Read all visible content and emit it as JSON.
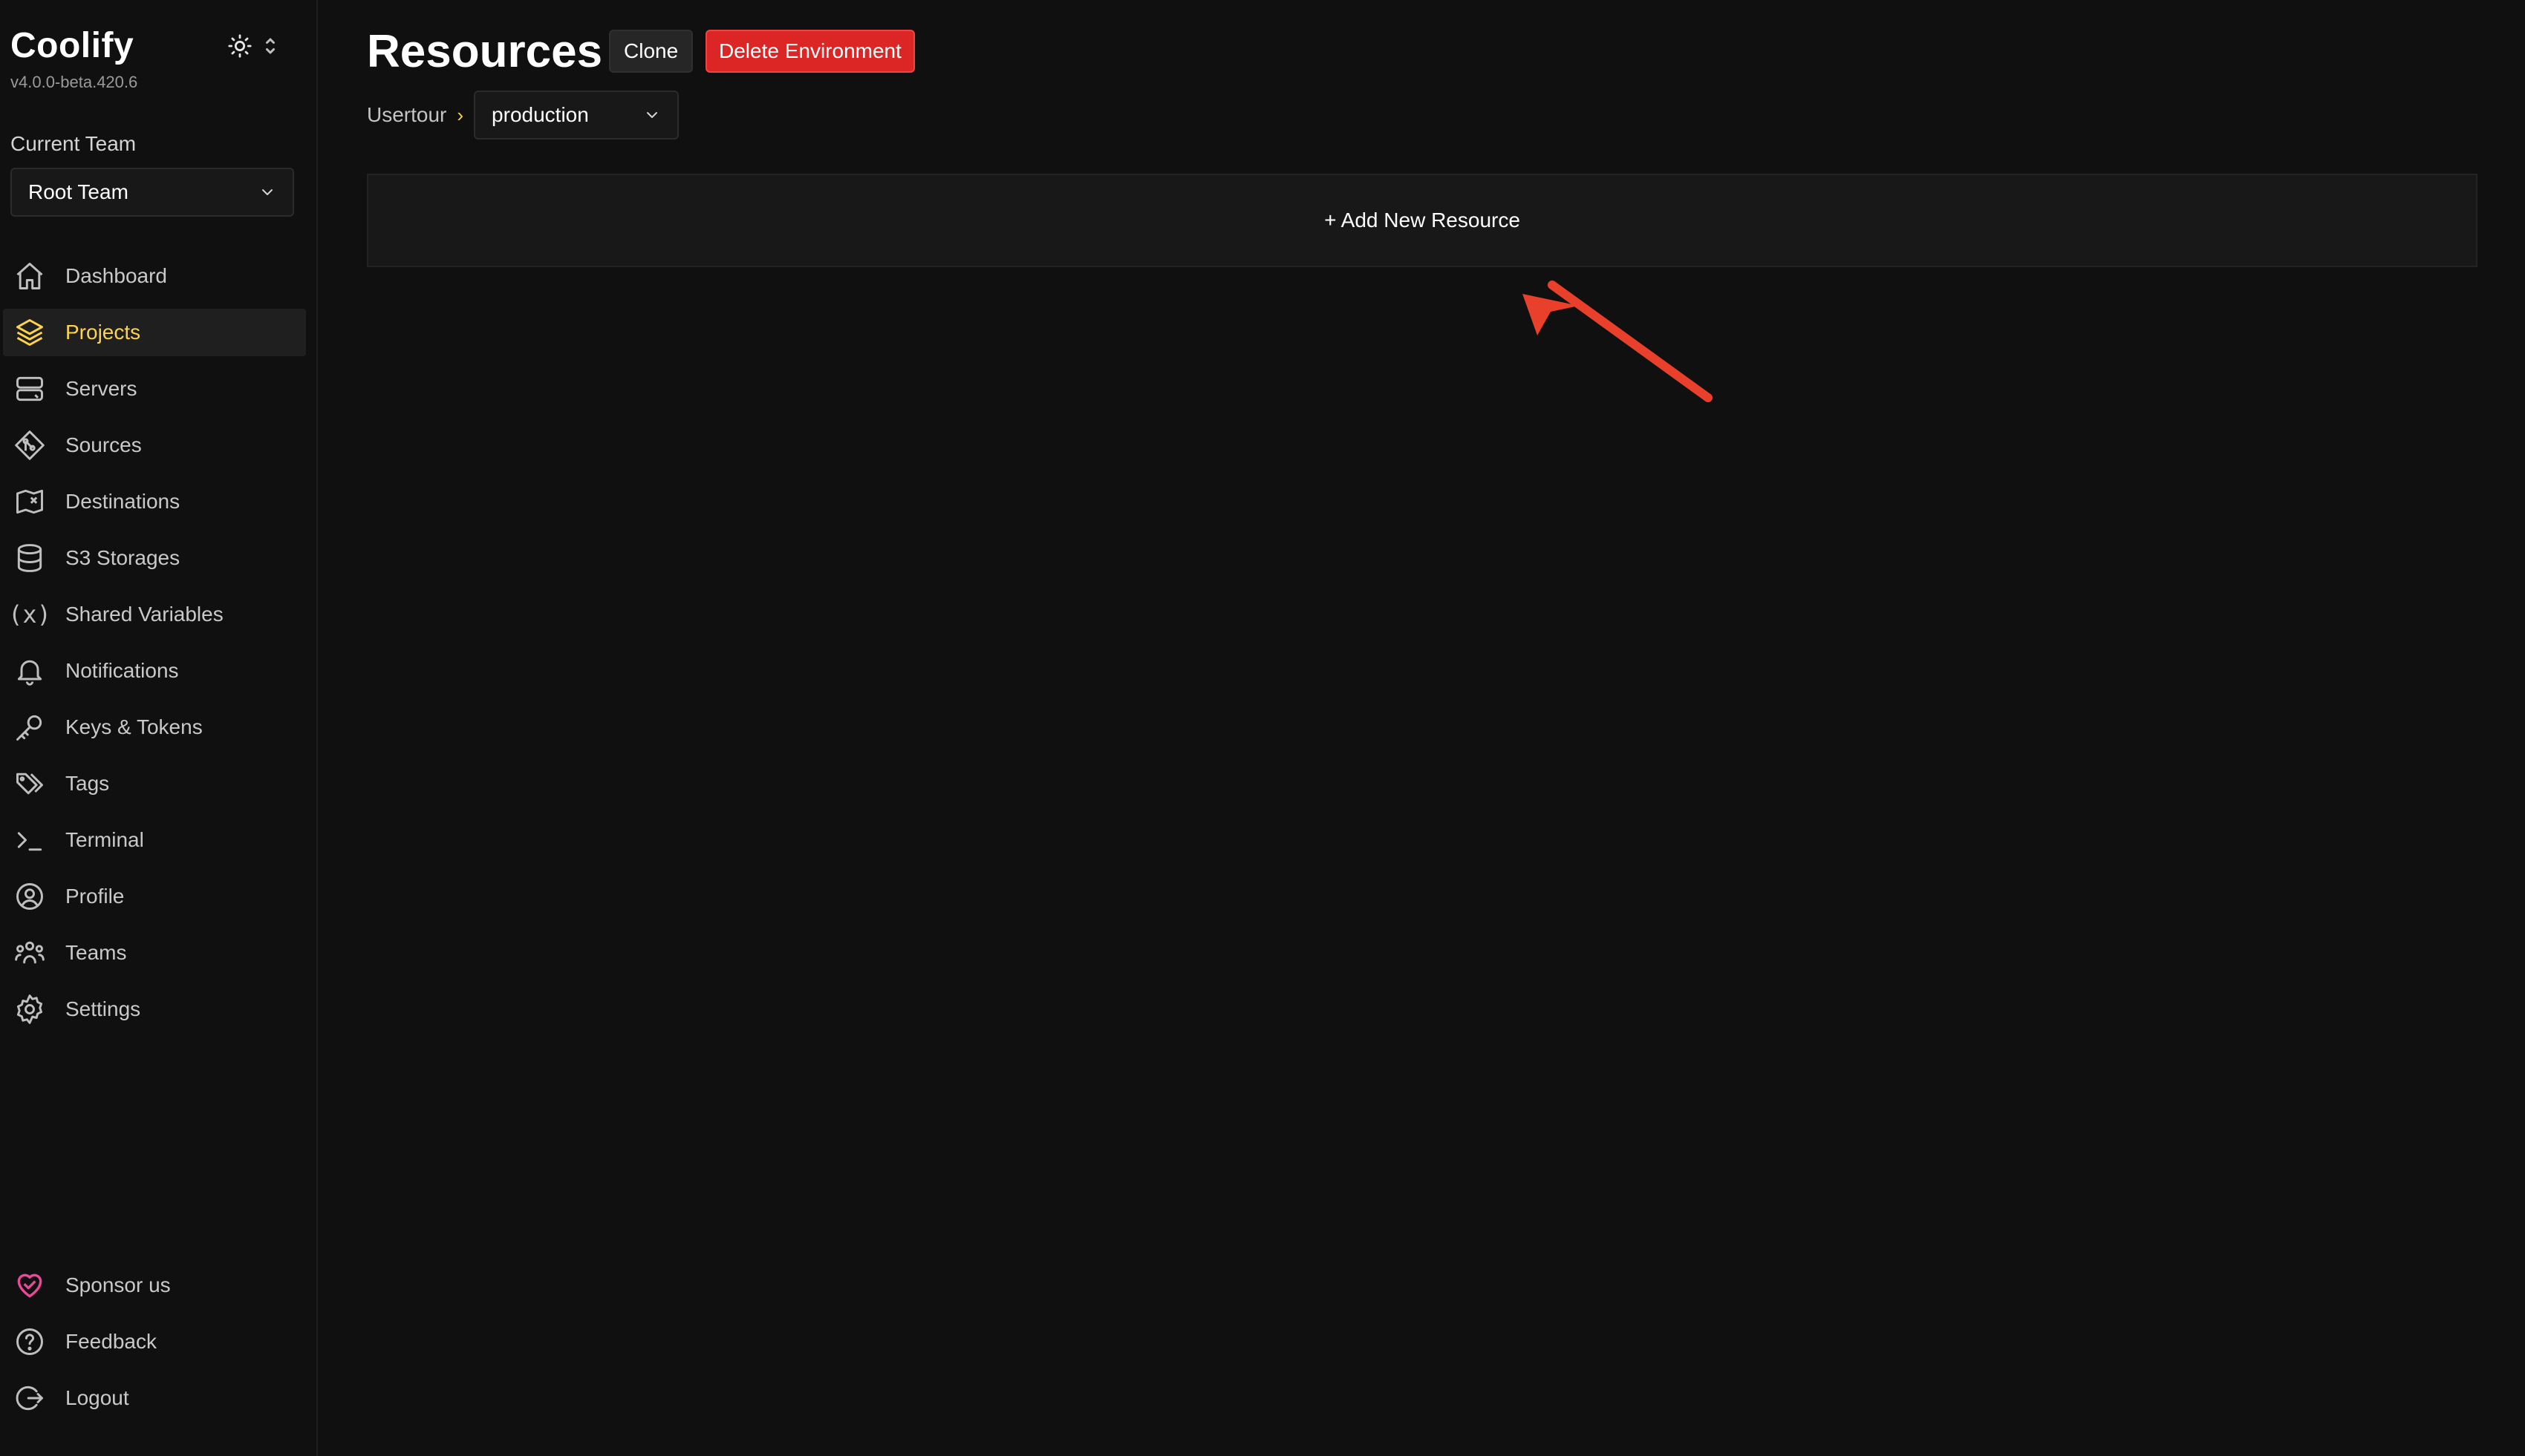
{
  "app": {
    "name": "Coolify",
    "version": "v4.0.0-beta.420.6"
  },
  "team": {
    "label": "Current Team",
    "selected": "Root Team"
  },
  "sidebar": {
    "items": [
      {
        "label": "Dashboard",
        "icon": "home-icon",
        "active": false
      },
      {
        "label": "Projects",
        "icon": "layers-icon",
        "active": true
      },
      {
        "label": "Servers",
        "icon": "server-icon",
        "active": false
      },
      {
        "label": "Sources",
        "icon": "git-icon",
        "active": false
      },
      {
        "label": "Destinations",
        "icon": "map-icon",
        "active": false
      },
      {
        "label": "S3 Storages",
        "icon": "database-icon",
        "active": false
      },
      {
        "label": "Shared Variables",
        "icon": "variable-icon",
        "active": false
      },
      {
        "label": "Notifications",
        "icon": "bell-icon",
        "active": false
      },
      {
        "label": "Keys & Tokens",
        "icon": "key-icon",
        "active": false
      },
      {
        "label": "Tags",
        "icon": "tags-icon",
        "active": false
      },
      {
        "label": "Terminal",
        "icon": "terminal-icon",
        "active": false
      },
      {
        "label": "Profile",
        "icon": "user-circle-icon",
        "active": false
      },
      {
        "label": "Teams",
        "icon": "users-icon",
        "active": false
      },
      {
        "label": "Settings",
        "icon": "gear-icon",
        "active": false
      }
    ],
    "bottom": [
      {
        "label": "Sponsor us",
        "icon": "heart-handshake-icon"
      },
      {
        "label": "Feedback",
        "icon": "help-circle-icon"
      },
      {
        "label": "Logout",
        "icon": "logout-icon"
      }
    ]
  },
  "main": {
    "title": "Resources",
    "clone_label": "Clone",
    "delete_label": "Delete Environment",
    "breadcrumb": {
      "project": "Usertour",
      "separator": "›",
      "environment": "production"
    },
    "add_resource_label": "+ Add New Resource"
  },
  "colors": {
    "background": "#101010",
    "panel": "#181818",
    "accent": "#fcd34d",
    "danger": "#dc2626",
    "sponsor": "#ec4899",
    "annotation_arrow": "#e8402a"
  }
}
